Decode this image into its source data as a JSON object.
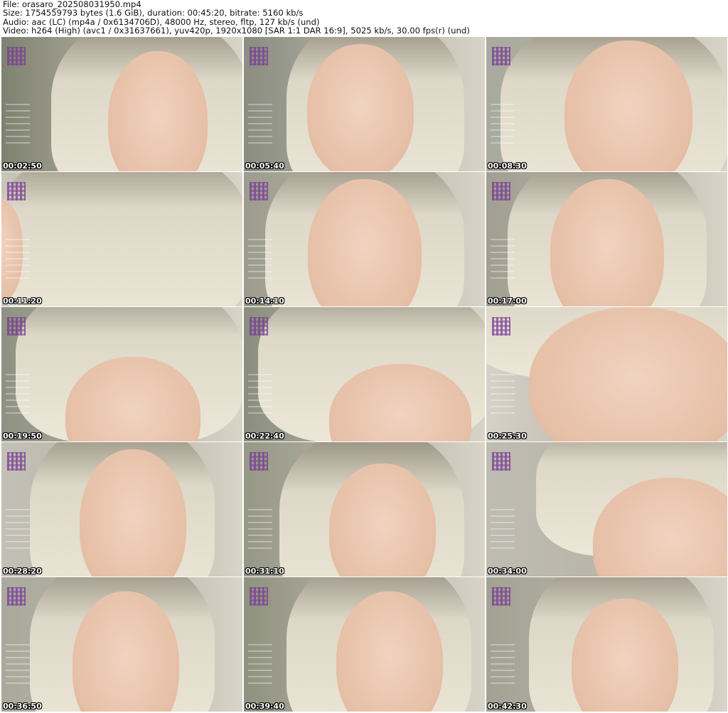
{
  "header": {
    "line1": "File: orasaro_202508031950.mp4",
    "line2": "Size: 1754559793 bytes (1.6 GiB), duration: 00:45:20, bitrate: 5160 kb/s",
    "line3": "Audio: aac (LC) (mp4a / 0x6134706D), 48000 Hz, stereo, fltp, 127 kb/s (und)",
    "line4": "Video: h264 (High) (avc1 / 0x31637661), yuv420p, 1920x1080 [SAR 1:1 DAR 16:9], 5025 kb/s, 30.00 fps(r) (und)"
  },
  "thumbnails": [
    {
      "timestamp": "00:02:50"
    },
    {
      "timestamp": "00:05:40"
    },
    {
      "timestamp": "00:08:30"
    },
    {
      "timestamp": "00:11:20"
    },
    {
      "timestamp": "00:14:10"
    },
    {
      "timestamp": "00:17:00"
    },
    {
      "timestamp": "00:19:50"
    },
    {
      "timestamp": "00:22:40"
    },
    {
      "timestamp": "00:25:30"
    },
    {
      "timestamp": "00:28:20"
    },
    {
      "timestamp": "00:31:10"
    },
    {
      "timestamp": "00:34:00"
    },
    {
      "timestamp": "00:36:50"
    },
    {
      "timestamp": "00:39:40"
    },
    {
      "timestamp": "00:42:30"
    }
  ],
  "colors": {
    "background": "#ffffff",
    "wall": "#b9b6ac",
    "hair": "#ddd8c8",
    "skin": "#e8c3ac",
    "timestamp_text": "#ffffff"
  }
}
